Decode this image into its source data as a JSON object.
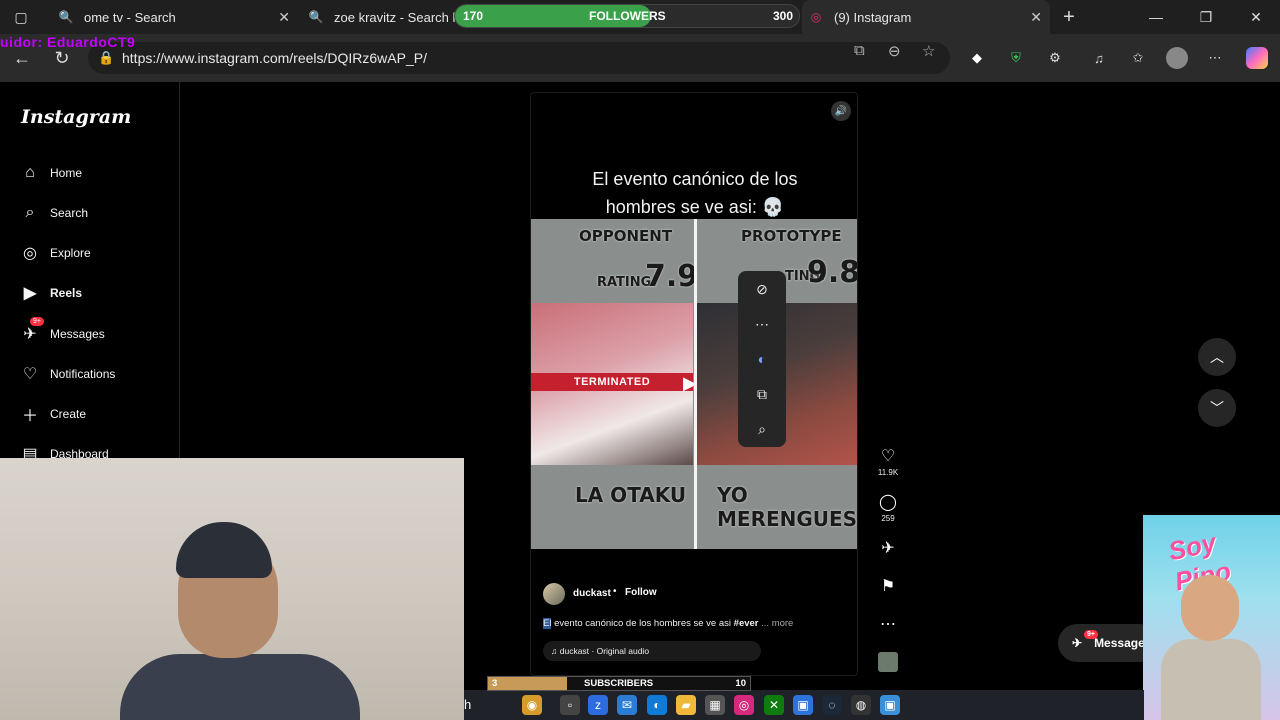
{
  "browser": {
    "tabs": [
      {
        "label": "ome tv - Search"
      },
      {
        "label": "zoe kravitz - Search li"
      },
      {
        "label": "earch"
      },
      {
        "label": "(9) Instagram"
      }
    ],
    "url": "https://www.instagram.com/reels/DQIRz6wAP_P/"
  },
  "overlay": {
    "followers_label": "FOLLOWERS",
    "followers_current": "170",
    "followers_goal": "300",
    "followers_progress": 0.57,
    "streamer_name": "uidor: EduardoCT9",
    "subscribers_label": "SUBSCRIBERS",
    "subscribers_current": "3",
    "subscribers_goal": "10",
    "subscribers_progress": 0.3
  },
  "sidebar": {
    "logo": "Instagram",
    "items": [
      {
        "label": "Home",
        "icon": "home-icon"
      },
      {
        "label": "Search",
        "icon": "search-icon"
      },
      {
        "label": "Explore",
        "icon": "compass-icon"
      },
      {
        "label": "Reels",
        "icon": "reels-icon"
      },
      {
        "label": "Messages",
        "icon": "messenger-icon",
        "badge": "9+"
      },
      {
        "label": "Notifications",
        "icon": "heart-icon"
      },
      {
        "label": "Create",
        "icon": "plus-icon"
      },
      {
        "label": "Dashboard",
        "icon": "dashboard-icon"
      }
    ]
  },
  "reel": {
    "overlay_text_line1": "El evento canónico de los",
    "overlay_text_line2": "hombres se ve asi: 💀",
    "video": {
      "left_header": "OPPONENT",
      "right_header": "PROTOTYPE",
      "left_rating_label": "RATING:",
      "left_rating": "7.9",
      "right_rating_label": "TING:",
      "right_rating": "9.8",
      "terminated": "TERMINATED",
      "left_name": "LA OTAKU",
      "right_name": "YO MERENGUES"
    },
    "username": "duckast",
    "follow_label": "Follow",
    "desc_highlight": "El",
    "desc_rest": " evento canónico de los hombres se ve asi ",
    "desc_hashtag": "#ever",
    "desc_more": "... more",
    "audio": "duckast · Original audio",
    "likes": "11.9K",
    "comments": "259"
  },
  "right_nav": {
    "messages_label": "Message",
    "messages_badge": "9+"
  },
  "poster": {
    "title": "Soy Pipo"
  },
  "taskbar": {
    "search_fragment": "h"
  }
}
